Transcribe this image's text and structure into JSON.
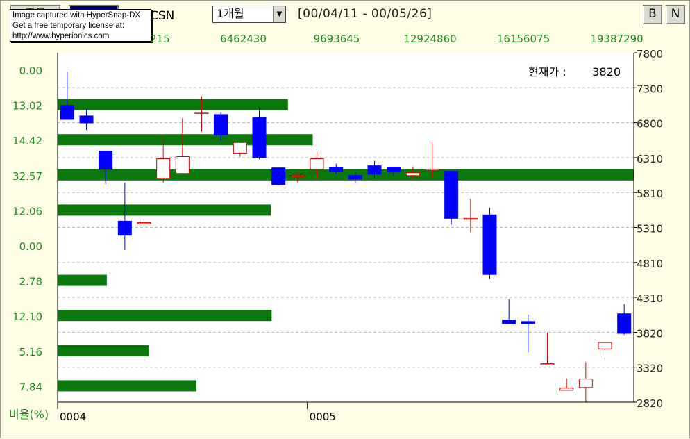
{
  "toolbar": {
    "tab_label": "종목",
    "code": "CSN",
    "period": "1개월",
    "date_range": "[00/04/11 - 00/05/26]",
    "b_button": "B",
    "n_button": "N",
    "watermark": [
      "Image captured with HyperSnap-DX",
      "Get a free temporary license at:",
      "http://www.hyperionics.com"
    ]
  },
  "colors": {
    "up": "#e00000",
    "down": "#0000ff",
    "volume_bar": "#0a780a",
    "text_green": "#1e8a1e"
  },
  "chart_data": {
    "type": "candlestick",
    "current_price_label": "현재가 :",
    "current_price": "3820",
    "y_ticks": [
      "7800",
      "7300",
      "6800",
      "6310",
      "5810",
      "5310",
      "4810",
      "4310",
      "3820",
      "3320",
      "2820"
    ],
    "ylim": [
      2820,
      7800
    ],
    "volume_ticks": [
      "215",
      "6462430",
      "9693645",
      "12924860",
      "16156075",
      "19387290"
    ],
    "volume_profile_label": "비율(%)",
    "volume_profile": [
      {
        "pct": "0.00",
        "value": 0.0
      },
      {
        "pct": "13.02",
        "value": 13.02
      },
      {
        "pct": "14.42",
        "value": 14.42
      },
      {
        "pct": "32.57",
        "value": 32.57
      },
      {
        "pct": "12.06",
        "value": 12.06
      },
      {
        "pct": "0.00",
        "value": 0.0
      },
      {
        "pct": "2.78",
        "value": 2.78
      },
      {
        "pct": "12.10",
        "value": 12.1
      },
      {
        "pct": "5.16",
        "value": 5.16
      },
      {
        "pct": "7.84",
        "value": 7.84
      }
    ],
    "x_labels": [
      {
        "label": "0004",
        "index": 0
      },
      {
        "label": "0005",
        "index": 13
      }
    ],
    "candles": [
      {
        "o": 7050,
        "h": 7530,
        "l": 6990,
        "c": 6850
      },
      {
        "o": 6900,
        "h": 7000,
        "l": 6700,
        "c": 6800
      },
      {
        "o": 6400,
        "h": 6300,
        "l": 5930,
        "c": 6140
      },
      {
        "o": 5400,
        "h": 5950,
        "l": 4990,
        "c": 5200
      },
      {
        "o": 5370,
        "h": 5430,
        "l": 5320,
        "c": 5380
      },
      {
        "o": 6010,
        "h": 6620,
        "l": 5950,
        "c": 6290
      },
      {
        "o": 6080,
        "h": 6870,
        "l": 6080,
        "c": 6320
      },
      {
        "o": 6950,
        "h": 7180,
        "l": 6680,
        "c": 6950
      },
      {
        "o": 6920,
        "h": 6960,
        "l": 6550,
        "c": 6630
      },
      {
        "o": 6370,
        "h": 6520,
        "l": 6320,
        "c": 6520
      },
      {
        "o": 6880,
        "h": 7030,
        "l": 6280,
        "c": 6310
      },
      {
        "o": 6160,
        "h": 6160,
        "l": 5910,
        "c": 5920
      },
      {
        "o": 6050,
        "h": 6100,
        "l": 5950,
        "c": 6050
      },
      {
        "o": 6140,
        "h": 6390,
        "l": 6000,
        "c": 6290
      },
      {
        "o": 6170,
        "h": 6220,
        "l": 6070,
        "c": 6110
      },
      {
        "o": 6050,
        "h": 6100,
        "l": 5940,
        "c": 6000
      },
      {
        "o": 6190,
        "h": 6260,
        "l": 6010,
        "c": 6070
      },
      {
        "o": 6170,
        "h": 6140,
        "l": 6040,
        "c": 6100
      },
      {
        "o": 6050,
        "h": 6180,
        "l": 5990,
        "c": 6090
      },
      {
        "o": 6140,
        "h": 6520,
        "l": 6020,
        "c": 6140
      },
      {
        "o": 6110,
        "h": 6110,
        "l": 5350,
        "c": 5440
      },
      {
        "o": 5440,
        "h": 5720,
        "l": 5240,
        "c": 5440
      },
      {
        "o": 5490,
        "h": 5590,
        "l": 4580,
        "c": 4640
      },
      {
        "o": 3990,
        "h": 4290,
        "l": 3950,
        "c": 3940
      },
      {
        "o": 3970,
        "h": 4070,
        "l": 3530,
        "c": 3940
      },
      {
        "o": 3370,
        "h": 3810,
        "l": 3370,
        "c": 3370
      },
      {
        "o": 2990,
        "h": 3160,
        "l": 2990,
        "c": 3020
      },
      {
        "o": 3030,
        "h": 3390,
        "l": 2820,
        "c": 3150
      },
      {
        "o": 3580,
        "h": 3670,
        "l": 3430,
        "c": 3670
      },
      {
        "o": 4080,
        "h": 4220,
        "l": 3780,
        "c": 3800
      }
    ]
  }
}
